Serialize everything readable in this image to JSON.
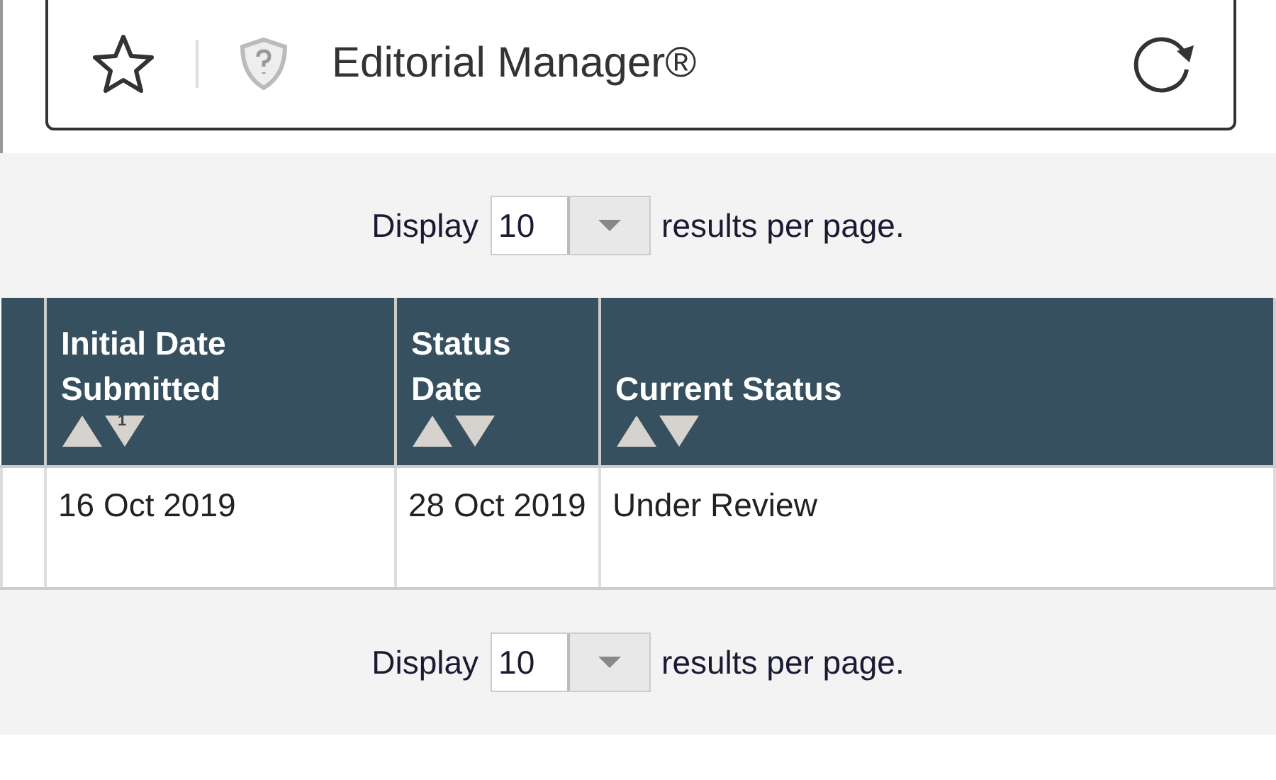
{
  "address_bar": {
    "title": "Editorial Manager®"
  },
  "pager_top": {
    "before": "Display",
    "value": "10",
    "after": "results per page."
  },
  "table": {
    "columns": [
      {
        "sortable": false
      },
      {
        "label": "Initial Date Submitted",
        "sortable": true,
        "sort_rank": "1"
      },
      {
        "label": "Status Date",
        "sortable": true
      },
      {
        "label": "Current Status",
        "sortable": true
      }
    ],
    "rows": [
      [
        "",
        "16 Oct 2019",
        "28 Oct 2019",
        "Under Review"
      ]
    ]
  },
  "pager_bottom": {
    "before": "Display",
    "value": "10",
    "after": "results per page."
  }
}
